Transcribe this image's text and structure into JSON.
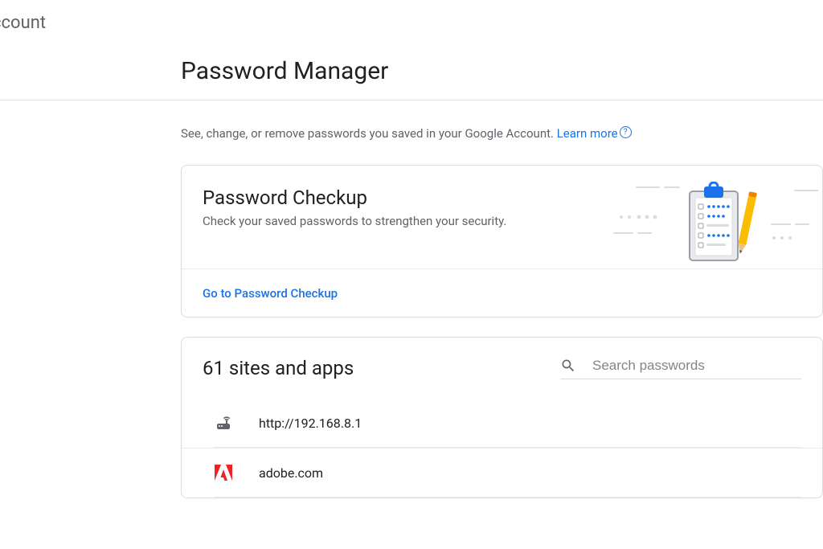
{
  "header": {
    "account_label": "ccount",
    "page_title": "Password Manager"
  },
  "description": {
    "text": "See, change, or remove passwords you saved in your Google Account. ",
    "learn_more": "Learn more"
  },
  "checkup": {
    "title": "Password Checkup",
    "subtitle": "Check your saved passwords to strengthen your security.",
    "link": "Go to Password Checkup"
  },
  "sites": {
    "title": "61 sites and apps",
    "search_placeholder": "Search passwords",
    "items": [
      {
        "name": "http://192.168.8.1",
        "icon": "router"
      },
      {
        "name": "adobe.com",
        "icon": "adobe"
      }
    ]
  }
}
